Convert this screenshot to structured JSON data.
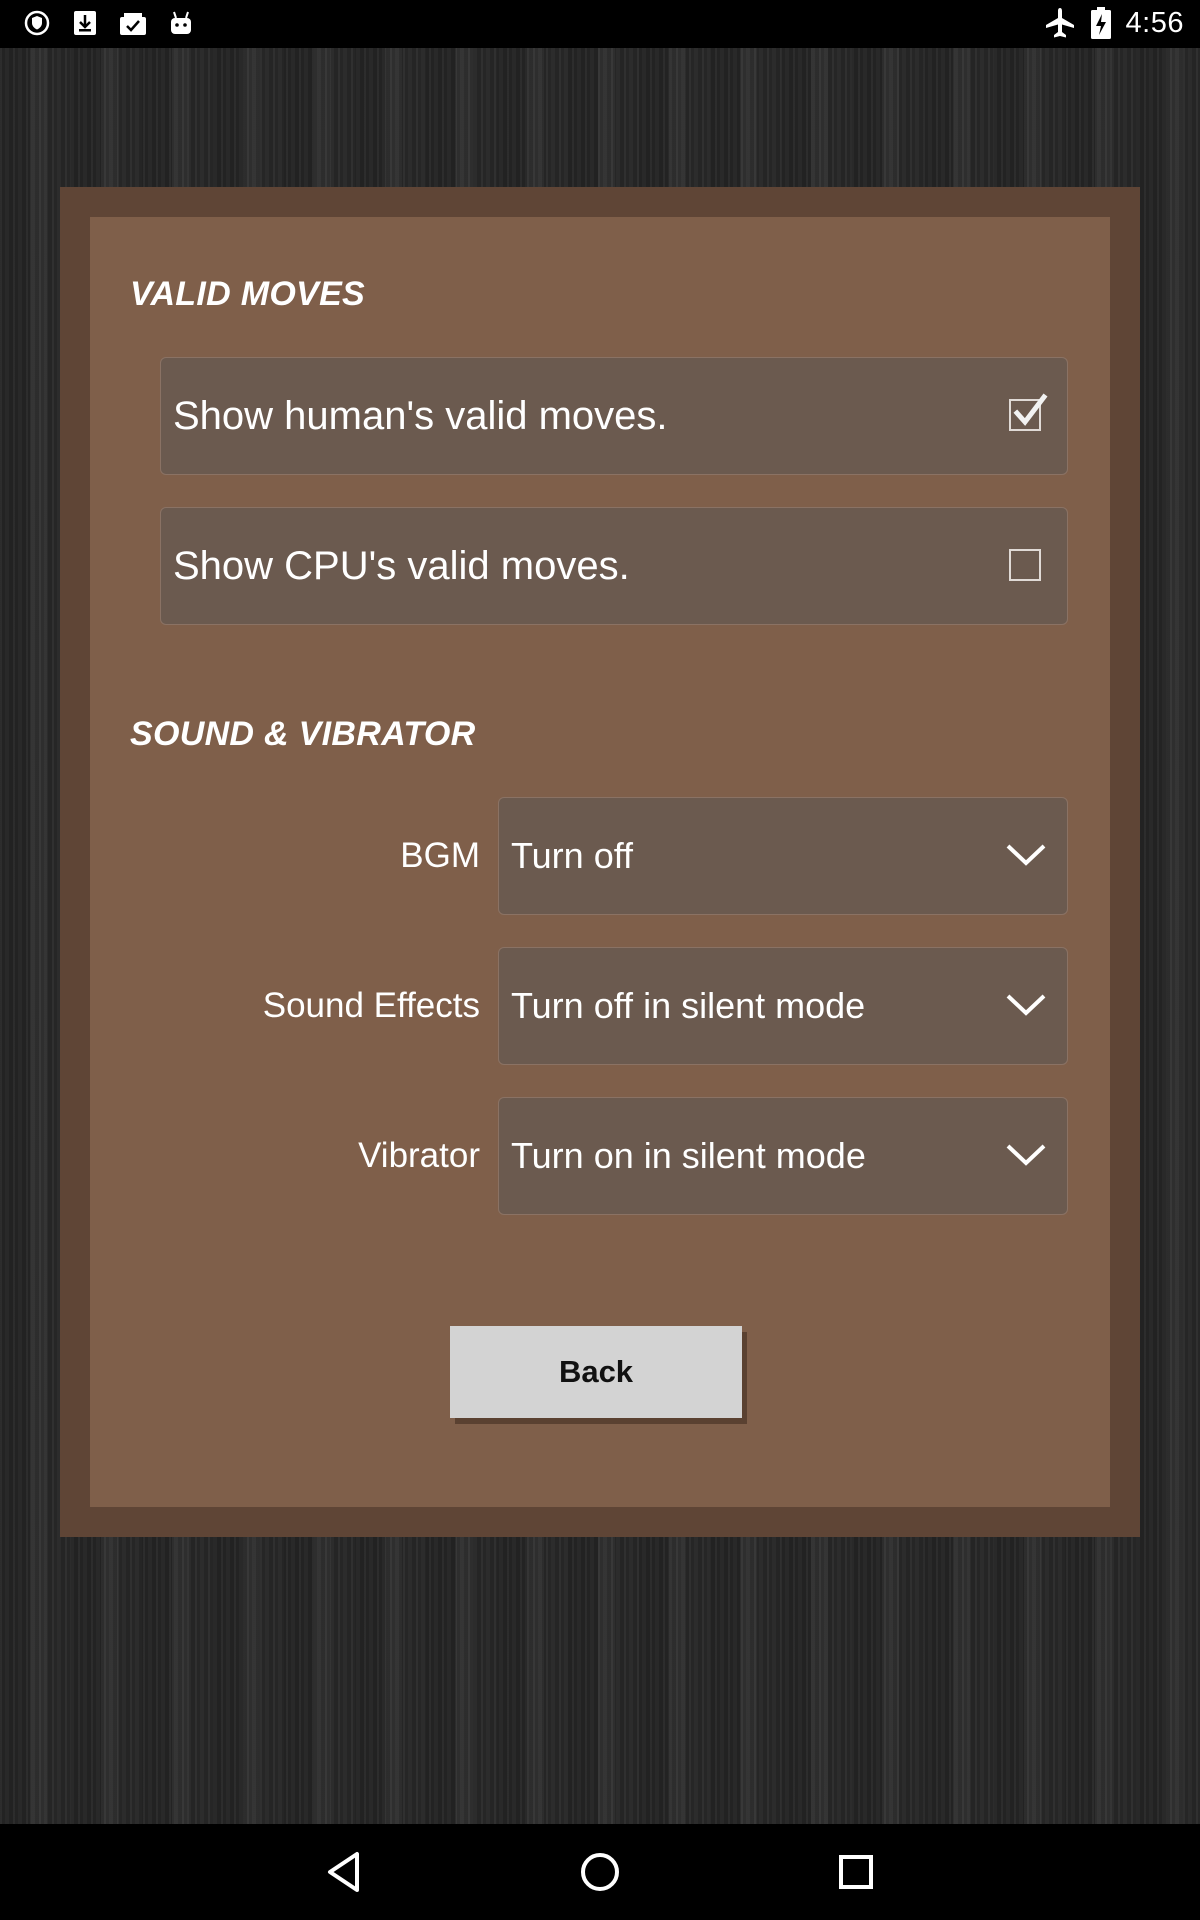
{
  "status_bar": {
    "left_icons": [
      "shield-icon",
      "download-icon",
      "clipboard-check-icon",
      "android-icon"
    ],
    "right_icons": [
      "airplane-mode-icon",
      "battery-charging-icon"
    ],
    "time": "4:56"
  },
  "valid_moves": {
    "title": "VALID MOVES",
    "options": [
      {
        "label": "Show human's valid moves.",
        "checked": true
      },
      {
        "label": "Show CPU's valid moves.",
        "checked": false
      }
    ]
  },
  "sound": {
    "title": "SOUND & VIBRATOR",
    "settings": [
      {
        "label": "BGM",
        "value": "Turn off"
      },
      {
        "label": "Sound Effects",
        "value": "Turn off in silent mode"
      },
      {
        "label": "Vibrator",
        "value": "Turn on in silent mode"
      }
    ]
  },
  "back_label": "Back",
  "nav_bar": {
    "icons": [
      "back-icon",
      "home-icon",
      "recents-icon"
    ]
  },
  "colors": {
    "dialog_frame": "#5f4536",
    "dialog_body": "#7f5f4a",
    "row_background": "#6b5a4f",
    "button_background": "#d3d3d3"
  }
}
